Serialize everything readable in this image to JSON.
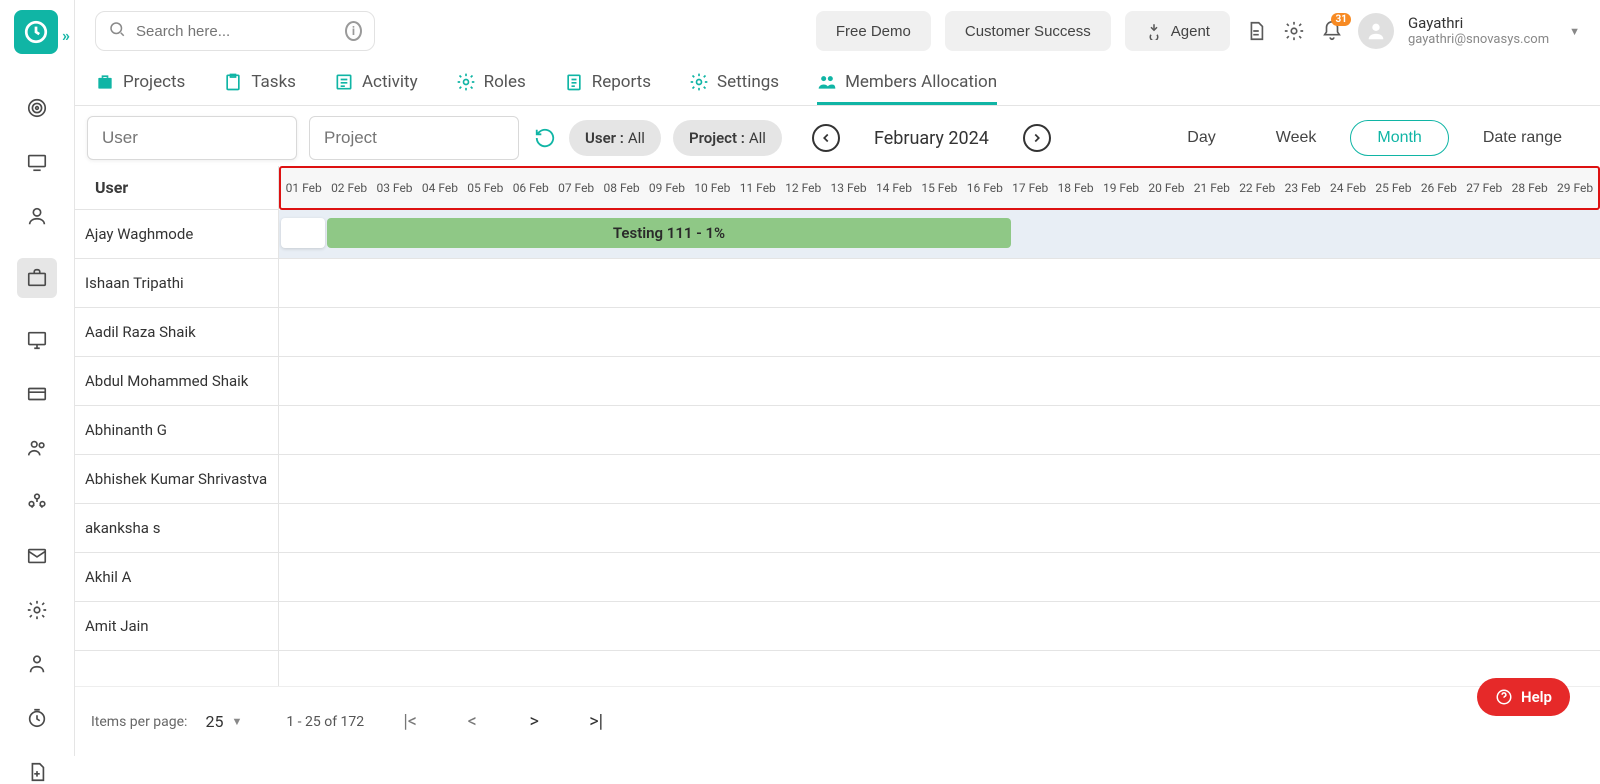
{
  "search": {
    "placeholder": "Search here..."
  },
  "top_buttons": {
    "free_demo": "Free Demo",
    "customer_success": "Customer Success",
    "agent": "Agent"
  },
  "notification_badge": "31",
  "user": {
    "name": "Gayathri",
    "email": "gayathri@snovasys.com"
  },
  "tabs": [
    {
      "label": "Projects"
    },
    {
      "label": "Tasks"
    },
    {
      "label": "Activity"
    },
    {
      "label": "Roles"
    },
    {
      "label": "Reports"
    },
    {
      "label": "Settings"
    },
    {
      "label": "Members Allocation"
    }
  ],
  "filters": {
    "user_placeholder": "User",
    "project_placeholder": "Project",
    "user_chip_label": "User :",
    "user_chip_value": "All",
    "project_chip_label": "Project :",
    "project_chip_value": "All"
  },
  "period": {
    "label": "February 2024"
  },
  "views": {
    "day": "Day",
    "week": "Week",
    "month": "Month",
    "date_range": "Date range",
    "active": "Month"
  },
  "grid": {
    "user_header": "User",
    "dates": [
      "01 Feb",
      "02 Feb",
      "03 Feb",
      "04 Feb",
      "05 Feb",
      "06 Feb",
      "07 Feb",
      "08 Feb",
      "09 Feb",
      "10 Feb",
      "11 Feb",
      "12 Feb",
      "13 Feb",
      "14 Feb",
      "15 Feb",
      "16 Feb",
      "17 Feb",
      "18 Feb",
      "19 Feb",
      "20 Feb",
      "21 Feb",
      "22 Feb",
      "23 Feb",
      "24 Feb",
      "25 Feb",
      "26 Feb",
      "27 Feb",
      "28 Feb",
      "29 Feb"
    ],
    "users": [
      "Ajay Waghmode",
      "Ishaan Tripathi",
      "Aadil Raza Shaik",
      "Abdul Mohammed Shaik",
      "Abhinanth G",
      "Abhishek Kumar Shrivastva",
      "akanksha s",
      "Akhil A",
      "Amit Jain"
    ],
    "bar_label": "Testing 111 - 1%"
  },
  "pagination": {
    "items_per_page_label": "Items per page:",
    "items_per_page": "25",
    "range": "1 - 25 of 172"
  },
  "help": {
    "label": "Help"
  }
}
